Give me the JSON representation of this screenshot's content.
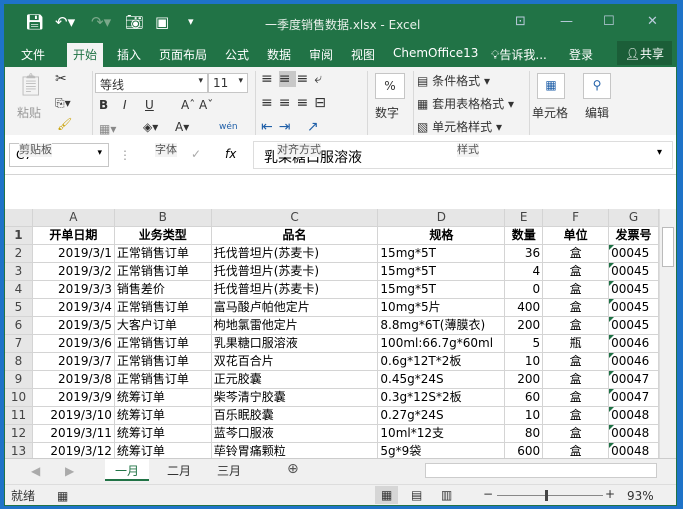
{
  "title": "一季度销售数据.xlsx - Excel",
  "tabs": [
    "文件",
    "开始",
    "插入",
    "页面布局",
    "公式",
    "数据",
    "审阅",
    "视图",
    "ChemOffice13"
  ],
  "tell_me": "告诉我...",
  "login": "登录",
  "share": "共享",
  "ribbon": {
    "paste": "粘贴",
    "clipboard": "剪贴板",
    "font_name": "等线",
    "font_size": "11",
    "font": "字体",
    "align": "对齐方式",
    "number": "数字",
    "cond_format": "条件格式",
    "table_format": "套用表格格式",
    "cell_style": "单元格样式",
    "styles": "样式",
    "cells": "单元格",
    "edit": "编辑",
    "bold": "B",
    "italic": "I",
    "underline": "U",
    "wen": "wén"
  },
  "formula_bar": {
    "name_box": "C7",
    "value": "乳果糖口服溶液",
    "fx": "fx"
  },
  "columns": [
    "A",
    "B",
    "C",
    "D",
    "E",
    "F",
    "G"
  ],
  "rows": [
    [
      "开单日期",
      "业务类型",
      "品名",
      "规格",
      "数量",
      "单位",
      "发票号"
    ],
    [
      "2019/3/1",
      "正常销售订单",
      "托伐普坦片(苏麦卡)",
      "15mg*5T",
      "36",
      "盒",
      "00045"
    ],
    [
      "2019/3/2",
      "正常销售订单",
      "托伐普坦片(苏麦卡)",
      "15mg*5T",
      "4",
      "盒",
      "00045"
    ],
    [
      "2019/3/3",
      "销售差价",
      "托伐普坦片(苏麦卡)",
      "15mg*5T",
      "0",
      "盒",
      "00045"
    ],
    [
      "2019/3/4",
      "正常销售订单",
      "富马酸卢帕他定片",
      "10mg*5片",
      "400",
      "盒",
      "00045"
    ],
    [
      "2019/3/5",
      "大客户订单",
      "枸地氯雷他定片",
      "8.8mg*6T(薄膜衣)",
      "200",
      "盒",
      "00045"
    ],
    [
      "2019/3/6",
      "正常销售订单",
      "乳果糖口服溶液",
      "100ml:66.7g*60ml",
      "5",
      "瓶",
      "00046"
    ],
    [
      "2019/3/7",
      "正常销售订单",
      "双花百合片",
      "0.6g*12T*2板",
      "10",
      "盒",
      "00046"
    ],
    [
      "2019/3/8",
      "正常销售订单",
      "正元胶囊",
      "0.45g*24S",
      "200",
      "盒",
      "00047"
    ],
    [
      "2019/3/9",
      "统筹订单",
      "柴芩清宁胶囊",
      "0.3g*12S*2板",
      "60",
      "盒",
      "00047"
    ],
    [
      "2019/3/10",
      "统筹订单",
      "百乐眠胶囊",
      "0.27g*24S",
      "10",
      "盒",
      "00048"
    ],
    [
      "2019/3/11",
      "统筹订单",
      "蓝芩口服液",
      "10ml*12支",
      "80",
      "盒",
      "00048"
    ],
    [
      "2019/3/12",
      "统筹订单",
      "荜铃胃痛颗粒",
      "5g*9袋",
      "600",
      "盒",
      "00048"
    ]
  ],
  "sheets": [
    "一月",
    "二月",
    "三月"
  ],
  "status": {
    "ready": "就绪",
    "zoom": "93%"
  }
}
